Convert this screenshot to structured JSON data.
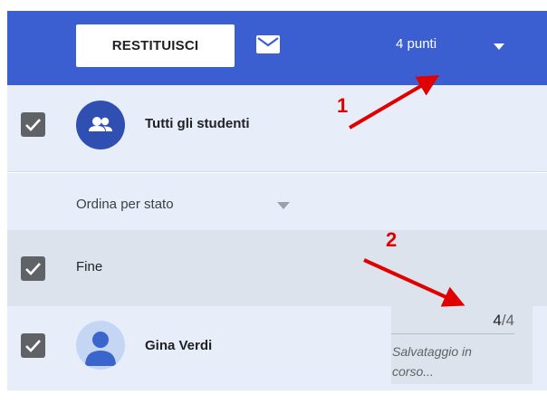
{
  "header": {
    "return_button": "RESTITUISCI",
    "mail_icon": "mail-icon",
    "points": "4 punti",
    "points_dropdown_icon": "caret-down-icon",
    "background": "#3b5fd0"
  },
  "all_students": {
    "label": "Tutti gli studenti",
    "checked": true,
    "icon": "people-icon"
  },
  "sort": {
    "label": "Ordina per stato",
    "dropdown_icon": "caret-down-icon"
  },
  "group": {
    "label": "Fine",
    "checked": true
  },
  "student": {
    "name": "Gina Verdi",
    "checked": true,
    "avatar_icon": "person-icon",
    "grade": "4",
    "grade_total": "/4",
    "status": "Salvataggio in corso..."
  },
  "annotations": [
    {
      "label": "1",
      "color": "#e00000"
    },
    {
      "label": "2",
      "color": "#e00000"
    }
  ]
}
